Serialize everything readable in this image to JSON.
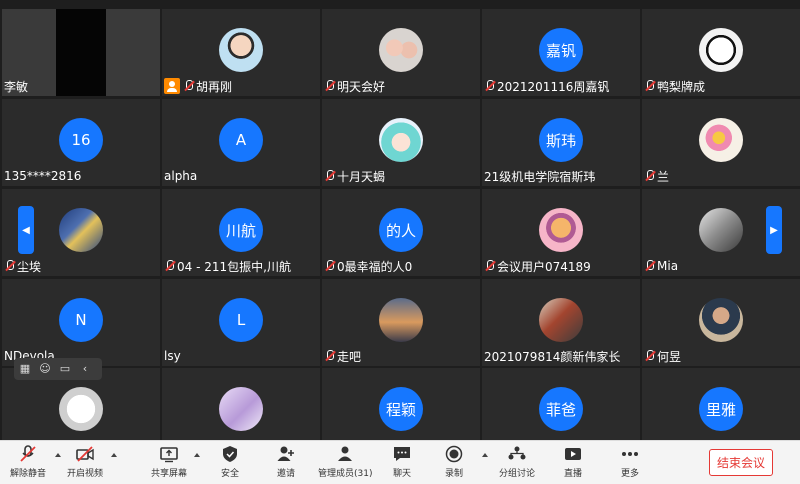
{
  "participants": [
    {
      "name": "李敏",
      "kind": "video",
      "muted": false
    },
    {
      "name": "胡再刚",
      "kind": "photo",
      "muted": true,
      "host": true,
      "avatar_icon": "cartoon-boy-avatar"
    },
    {
      "name": "明天会好",
      "kind": "photo",
      "muted": true,
      "avatar_icon": "children-photo-avatar"
    },
    {
      "name": "2021201116周嘉钒",
      "kind": "text",
      "muted": true,
      "avatar_text": "嘉钒"
    },
    {
      "name": "鸭梨牌成",
      "kind": "photo",
      "muted": true,
      "avatar_icon": "cow-cartoon-avatar"
    },
    {
      "name": "135****2816",
      "kind": "text",
      "muted": false,
      "avatar_text": "16"
    },
    {
      "name": "alpha",
      "kind": "text",
      "muted": false,
      "avatar_text": "A"
    },
    {
      "name": "十月天蝎",
      "kind": "photo",
      "muted": true,
      "avatar_icon": "anime-girl-avatar"
    },
    {
      "name": "21级机电学院宿斯玮",
      "kind": "text",
      "muted": false,
      "avatar_text": "斯玮"
    },
    {
      "name": "兰",
      "kind": "photo",
      "muted": true,
      "avatar_icon": "flower-avatar"
    },
    {
      "name": "尘埃",
      "kind": "photo",
      "muted": true,
      "avatar_icon": "starry-night-avatar"
    },
    {
      "name": "04 - 211包振中,川航",
      "kind": "text",
      "muted": true,
      "avatar_text": "川航"
    },
    {
      "name": "0最幸福的人0",
      "kind": "text",
      "muted": true,
      "avatar_text": "的人"
    },
    {
      "name": "会议用户074189",
      "kind": "photo",
      "muted": true,
      "avatar_icon": "cartoon-character-avatar"
    },
    {
      "name": "Mia",
      "kind": "photo",
      "muted": true,
      "avatar_icon": "bw-photo-avatar"
    },
    {
      "name": "NDevola",
      "kind": "text",
      "muted": false,
      "avatar_text": "N"
    },
    {
      "name": "lsy",
      "kind": "text",
      "muted": false,
      "avatar_text": "L"
    },
    {
      "name": "走吧",
      "kind": "photo",
      "muted": true,
      "avatar_icon": "sunset-bottle-avatar"
    },
    {
      "name": "2021079814颜新伟家长",
      "kind": "photo",
      "muted": false,
      "avatar_icon": "dragon-art-avatar"
    },
    {
      "name": "何昱",
      "kind": "photo",
      "muted": true,
      "avatar_icon": "man-photo-avatar"
    },
    {
      "name": "",
      "kind": "photo",
      "muted": false,
      "avatar_icon": "sketch-avatar"
    },
    {
      "name": "",
      "kind": "photo",
      "muted": false,
      "avatar_icon": "purple-anime-avatar"
    },
    {
      "name": "",
      "kind": "text",
      "muted": false,
      "avatar_text": "程颖"
    },
    {
      "name": "",
      "kind": "text",
      "muted": false,
      "avatar_text": "菲爸"
    },
    {
      "name": "",
      "kind": "text",
      "muted": false,
      "avatar_text": "里雅"
    }
  ],
  "toolbar": {
    "unmute": "解除静音",
    "start_video": "开启视频",
    "share_screen": "共享屏幕",
    "security": "安全",
    "invite": "邀请",
    "manage_members": "管理成员(31)",
    "chat": "聊天",
    "record": "录制",
    "breakout": "分组讨论",
    "live": "直播",
    "more": "更多",
    "end_meeting": "结束会议"
  },
  "colors": {
    "accent": "#1677ff",
    "danger": "#e53935",
    "host_badge": "#ff8a00"
  }
}
